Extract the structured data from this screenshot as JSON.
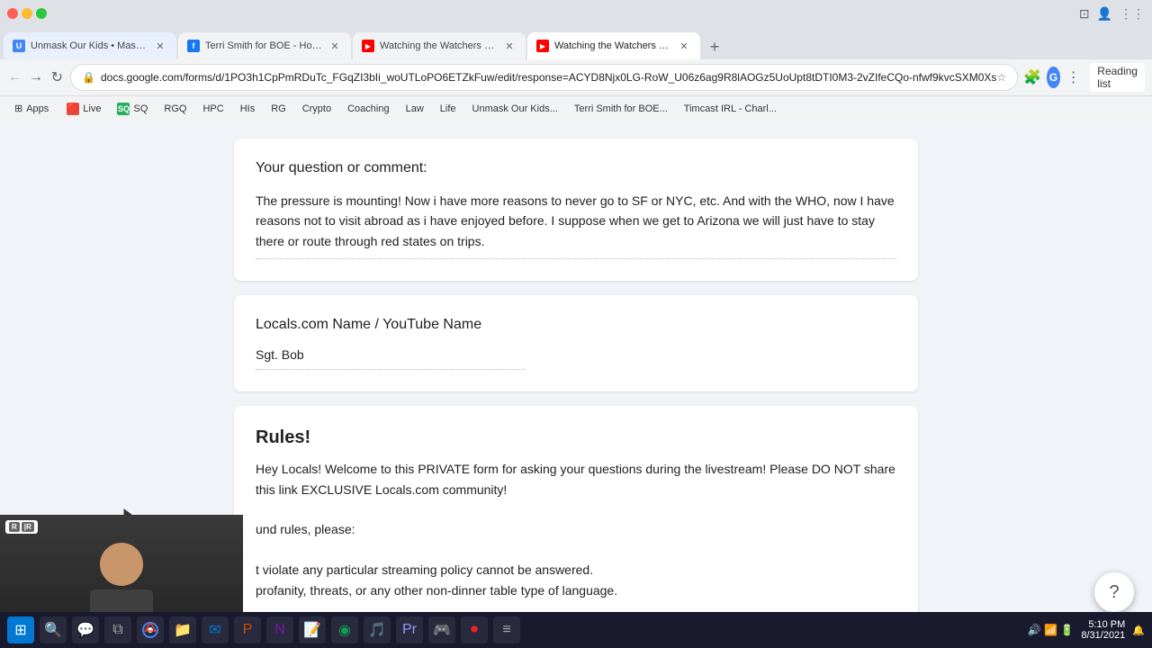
{
  "browser": {
    "tabs": [
      {
        "id": "tab1",
        "label": "Unmask Our Kids • Mask Choice...",
        "favicon_color": "#4285f4",
        "favicon_letter": "U",
        "active": false
      },
      {
        "id": "tab2",
        "label": "Terri Smith for BOE - Home | Fa...",
        "favicon_color": "#1877f2",
        "favicon_letter": "f",
        "active": false
      },
      {
        "id": "tab3",
        "label": "Watching the Watchers Show Q...",
        "favicon_color": "#ff0000",
        "favicon_letter": "▶",
        "active": false
      },
      {
        "id": "tab4",
        "label": "Watching the Watchers Show C...",
        "favicon_color": "#ff0000",
        "favicon_letter": "▶",
        "active": true
      }
    ],
    "new_tab_label": "+",
    "address": "docs.google.com/forms/d/1PO3h1CpPmRDuTc_FGqZI3bIi_woUTLoPO6ETZkFuw/edit/response=ACYD8Njx0LG-RoW_U06z6ag9R8lAOGz5UoUpt8tDTI0M3-2vZIfeCQo-nfwf9kvcSXM0Xs",
    "bookmarks": [
      {
        "label": "Apps"
      },
      {
        "label": "Live"
      },
      {
        "label": "SQ"
      },
      {
        "label": "RGQ"
      },
      {
        "label": "HPC"
      },
      {
        "label": "HIs"
      },
      {
        "label": "RG"
      },
      {
        "label": "Crypto"
      },
      {
        "label": "Coaching"
      },
      {
        "label": "Law"
      },
      {
        "label": "Life"
      },
      {
        "label": "Unmask Our Kids..."
      },
      {
        "label": "Terri Smith for BOE..."
      },
      {
        "label": "Timcast IRL - Charl..."
      }
    ],
    "reading_list": "Reading list"
  },
  "form": {
    "card1": {
      "question": "Your question or comment:",
      "answer": "The pressure is mounting!  Now i have more reasons to never go to SF or NYC, etc.  And with the WHO, now I have reasons not to visit abroad as i have enjoyed before.  I suppose when we get to Arizona we will just have to stay there or route through red states on trips."
    },
    "card2": {
      "question": "Locals.com Name / YouTube Name",
      "answer": "Sgt. Bob"
    },
    "card3": {
      "title": "Rules!",
      "text": "Hey Locals! Welcome to this PRIVATE form for asking your questions during the livestream! Please DO NOT share this link EXCLUSIVE Locals.com community!\n\nund rules, please:\n\nt violate any particular streaming policy cannot be answered.\nprofanity, threats, or any other non-dinner table type of language."
    }
  },
  "help_button": "?",
  "taskbar": {
    "time": "5:10 PM",
    "date": "8/31/2021"
  },
  "window": {
    "minimize": "−",
    "maximize": "□",
    "close": "✕"
  }
}
